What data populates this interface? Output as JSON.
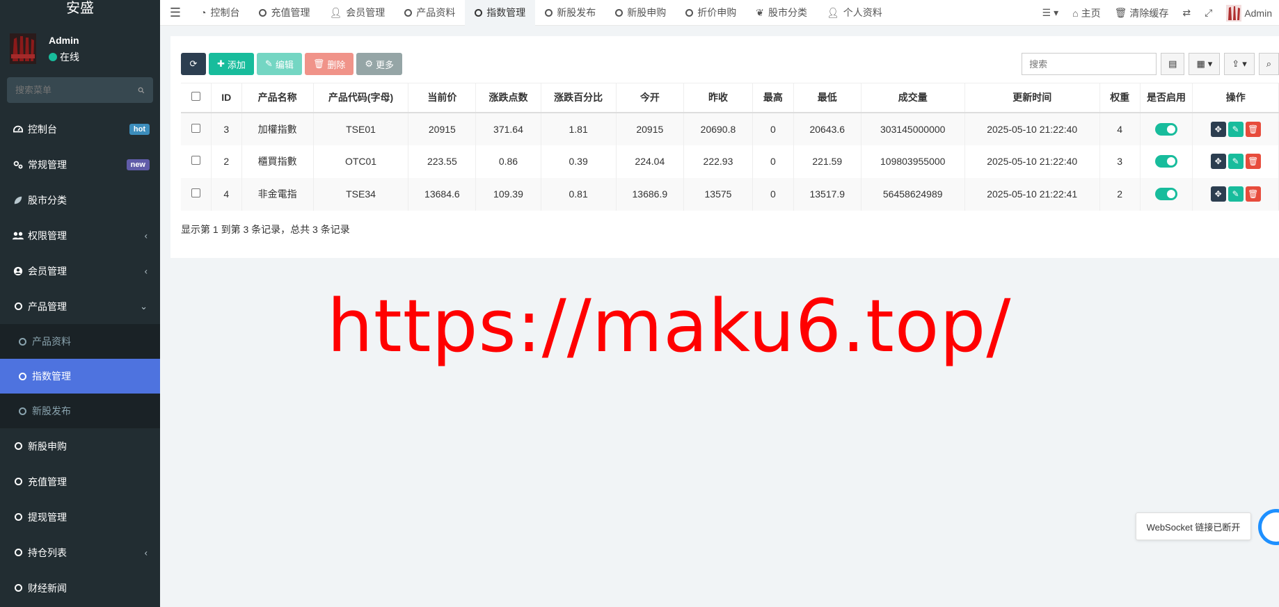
{
  "sidebar": {
    "logo": "安盛",
    "user": {
      "name": "Admin",
      "status": "在线"
    },
    "search_placeholder": "搜索菜单",
    "items": [
      {
        "label": "控制台",
        "icon": "dashboard-icon",
        "badge": "hot"
      },
      {
        "label": "常规管理",
        "icon": "cogs-icon",
        "badge": "new"
      },
      {
        "label": "股市分类",
        "icon": "leaf-icon"
      },
      {
        "label": "权限管理",
        "icon": "group-icon"
      },
      {
        "label": "会员管理",
        "icon": "user-circle-icon"
      },
      {
        "label": "产品管理",
        "icon": "circle-o-icon"
      }
    ],
    "sub_items": [
      {
        "label": "产品资料"
      },
      {
        "label": "指数管理"
      },
      {
        "label": "新股发布"
      }
    ],
    "items2": [
      {
        "label": "新股申购"
      },
      {
        "label": "充值管理"
      },
      {
        "label": "提现管理"
      },
      {
        "label": "持仓列表"
      },
      {
        "label": "财经新闻"
      }
    ]
  },
  "topnav": {
    "tabs": [
      {
        "label": "控制台",
        "icon": "dashboard-icon"
      },
      {
        "label": "充值管理",
        "icon": "circle-o-icon"
      },
      {
        "label": "会员管理",
        "icon": "user-icon"
      },
      {
        "label": "产品资料",
        "icon": "circle-o-icon"
      },
      {
        "label": "指数管理",
        "icon": "circle-o-icon"
      },
      {
        "label": "新股发布",
        "icon": "circle-o-icon"
      },
      {
        "label": "新股申购",
        "icon": "circle-o-icon"
      },
      {
        "label": "折价申购",
        "icon": "circle-o-icon"
      },
      {
        "label": "股市分类",
        "icon": "leaf-icon"
      },
      {
        "label": "个人资料",
        "icon": "user-icon"
      }
    ],
    "right": {
      "home": "主页",
      "clear_cache": "清除缓存",
      "admin": "Admin"
    }
  },
  "toolbar": {
    "add": "添加",
    "edit": "编辑",
    "delete": "删除",
    "more": "更多",
    "search_placeholder": "搜索"
  },
  "table": {
    "headers": [
      "ID",
      "产品名称",
      "产品代码(字母)",
      "当前价",
      "涨跌点数",
      "涨跌百分比",
      "今开",
      "昨收",
      "最高",
      "最低",
      "成交量",
      "更新时间",
      "权重",
      "是否启用",
      "操作"
    ],
    "rows": [
      [
        "3",
        "加權指數",
        "TSE01",
        "20915",
        "371.64",
        "1.81",
        "20915",
        "20690.8",
        "0",
        "20643.6",
        "303145000000",
        "2025-05-10 21:22:40",
        "4"
      ],
      [
        "2",
        "櫃買指數",
        "OTC01",
        "223.55",
        "0.86",
        "0.39",
        "224.04",
        "222.93",
        "0",
        "221.59",
        "109803955000",
        "2025-05-10 21:22:40",
        "3"
      ],
      [
        "4",
        "非金電指",
        "TSE34",
        "13684.6",
        "109.39",
        "0.81",
        "13686.9",
        "13575",
        "0",
        "13517.9",
        "56458624989",
        "2025-05-10 21:22:41",
        "2"
      ]
    ],
    "pager_info": "显示第 1 到第 3 条记录，总共 3 条记录"
  },
  "watermark": "https://maku6.top/",
  "websocket_tip": "WebSocket 链接已断开",
  "colors": {
    "sidebar_bg": "#222d32",
    "active": "#4e73df",
    "success": "#18bc9c",
    "danger": "#e74c3c",
    "watermark": "#ff0000"
  }
}
